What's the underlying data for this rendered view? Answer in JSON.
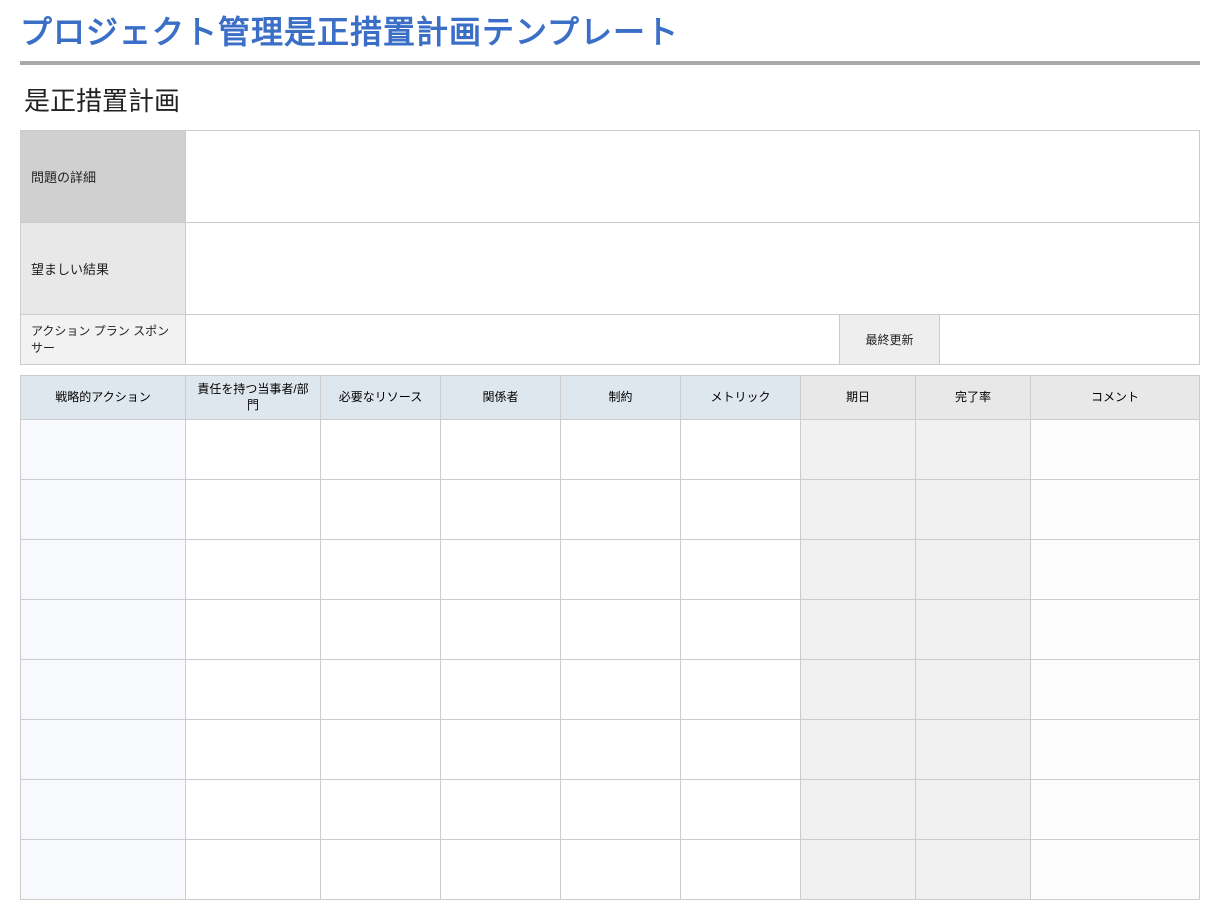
{
  "title": "プロジェクト管理是正措置計画テンプレート",
  "subtitle": "是正措置計画",
  "meta": {
    "problem_label": "問題の詳細",
    "problem_value": "",
    "desired_label": "望ましい結果",
    "desired_value": "",
    "sponsor_label": "アクション プラン スポンサー",
    "sponsor_value": "",
    "updated_label": "最終更新",
    "updated_value": ""
  },
  "columns": {
    "c1": "戦略的アクション",
    "c2": "責任を持つ当事者/部門",
    "c3": "必要なリソース",
    "c4": "関係者",
    "c5": "制約",
    "c6": "メトリック",
    "c7": "期日",
    "c8": "完了率",
    "c9": "コメント"
  },
  "rows": [
    {
      "c1": "",
      "c2": "",
      "c3": "",
      "c4": "",
      "c5": "",
      "c6": "",
      "c7": "",
      "c8": "",
      "c9": ""
    },
    {
      "c1": "",
      "c2": "",
      "c3": "",
      "c4": "",
      "c5": "",
      "c6": "",
      "c7": "",
      "c8": "",
      "c9": ""
    },
    {
      "c1": "",
      "c2": "",
      "c3": "",
      "c4": "",
      "c5": "",
      "c6": "",
      "c7": "",
      "c8": "",
      "c9": ""
    },
    {
      "c1": "",
      "c2": "",
      "c3": "",
      "c4": "",
      "c5": "",
      "c6": "",
      "c7": "",
      "c8": "",
      "c9": ""
    },
    {
      "c1": "",
      "c2": "",
      "c3": "",
      "c4": "",
      "c5": "",
      "c6": "",
      "c7": "",
      "c8": "",
      "c9": ""
    },
    {
      "c1": "",
      "c2": "",
      "c3": "",
      "c4": "",
      "c5": "",
      "c6": "",
      "c7": "",
      "c8": "",
      "c9": ""
    },
    {
      "c1": "",
      "c2": "",
      "c3": "",
      "c4": "",
      "c5": "",
      "c6": "",
      "c7": "",
      "c8": "",
      "c9": ""
    },
    {
      "c1": "",
      "c2": "",
      "c3": "",
      "c4": "",
      "c5": "",
      "c6": "",
      "c7": "",
      "c8": "",
      "c9": ""
    }
  ]
}
